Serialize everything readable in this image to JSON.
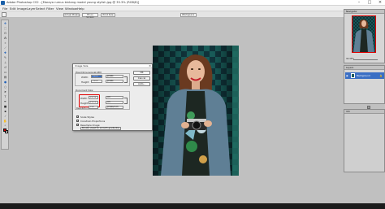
{
  "window": {
    "title": "Adobe Photoshop CS2 - [Maraya rumus bintang model young stylish.jpg @ 33.3% (RGB/8)]",
    "controls": [
      "–",
      "□",
      "×"
    ]
  },
  "menu": [
    "File",
    "Edit",
    "Image",
    "Layer",
    "Select",
    "Filter",
    "View",
    "Window",
    "Help"
  ],
  "options_bar": {
    "buttons": [
      "Actual Pixels",
      "Fit on Screen",
      "Print Size"
    ],
    "workspace": "Workspace"
  },
  "toolbox": {
    "tools": [
      "move-icon",
      "marquee-icon",
      "lasso-icon",
      "magic-wand-icon",
      "crop-icon",
      "slice-icon",
      "healing-icon",
      "brush-icon",
      "stamp-icon",
      "history-brush-icon",
      "eraser-icon",
      "gradient-icon",
      "blur-icon",
      "dodge-icon",
      "path-select-icon",
      "type-icon",
      "pen-icon",
      "shape-icon",
      "notes-icon",
      "eyedropper-icon",
      "hand-icon",
      "zoom-icon"
    ],
    "foreground_color": "#d30000",
    "background_color": "#ffffff"
  },
  "dialog": {
    "title": "Image Size",
    "pixel_dimensions_label": "Pixel Dimensions:",
    "pixel_dimensions_value": "4.18M",
    "width_label": "Width:",
    "width_value": "1000",
    "width_unit": "pixels",
    "height_label": "Height:",
    "height_value": "1500",
    "height_unit": "pixels",
    "document_size_label": "Document Size:",
    "doc_width_label": "Width:",
    "doc_width_value": "14.14",
    "doc_width_unit": "cm",
    "doc_height_label": "Height:",
    "doc_height_value": "21.21",
    "doc_height_unit": "cm",
    "resolution_label": "Resolution:",
    "resolution_value": "180",
    "resolution_unit": "pixels/inch",
    "scale_styles": "Scale Styles",
    "constrain_proportions": "Constrain Proportions",
    "resample_image": "Resample Image:",
    "resample_method": "Bicubic (best for smooth gradients)",
    "ok_label": "OK",
    "cancel_label": "Cancel",
    "auto_label": "Auto..."
  },
  "navigator": {
    "tab": "Navigator",
    "zoom": "33.33%"
  },
  "layers": {
    "tab": "Layers",
    "layer_name": "Background"
  },
  "small_panel": {
    "tab": "Info"
  },
  "accent_colors": {
    "highlight_red": "#e00000",
    "selection_blue": "#3b6fc4"
  }
}
